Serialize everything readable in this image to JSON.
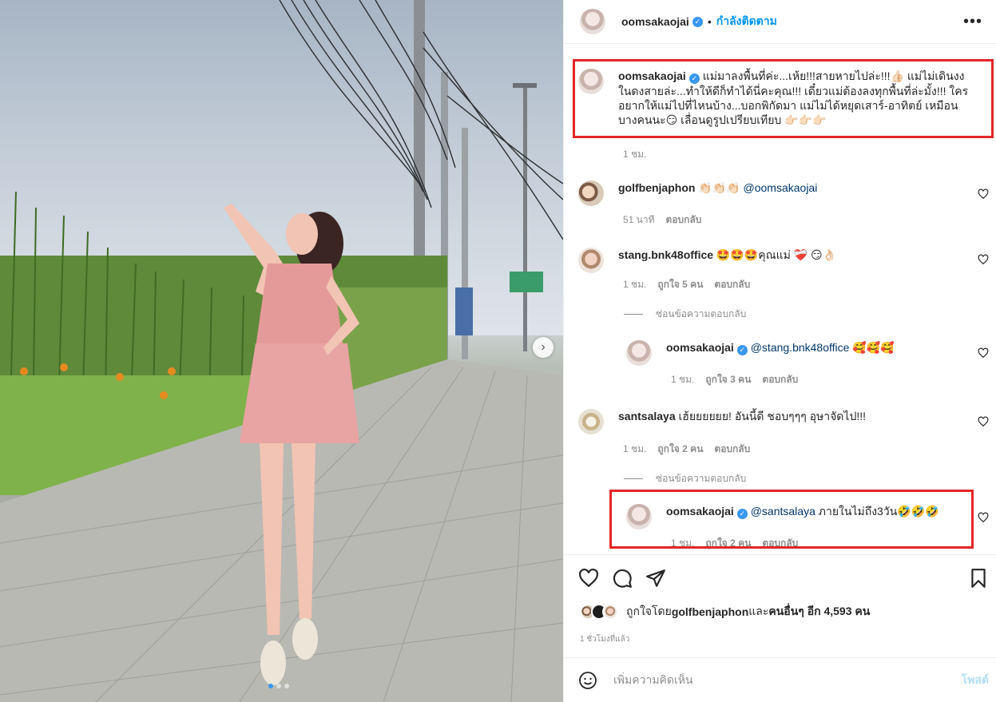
{
  "post": {
    "username": "oomsakaojai",
    "follow_status": "กำลังติดตาม",
    "caption": "แม่มาลงพื้นที่ค่ะ...เห้ย!!!สายหายไปล่ะ!!!👍🏻 แม่ไม่เดินงงในดงสายล่ะ...ทำให้ดีก็ทำได้นี่คะคุณ!!! เดี๋ยวแม่ต้องลงทุกพื้นที่ล่ะมั้ง!!! ใครอยากให้แม่ไปที่ไหนบ้าง...บอกพิกัดมา แม่ไม่ได้หยุดเสาร์-อาทิตย์ เหมือนบางคนนะ😏 เลื่อนดูรูปเปรียบเทียบ 👉🏻👉🏻👉🏻",
    "caption_time": "1 ชม."
  },
  "comments": [
    {
      "username": "golfbenjaphon",
      "emoji": "👏🏻👏🏻👏🏻",
      "text": " ",
      "mention": "@oomsakaojai",
      "time": "51 นาที",
      "reply": "ตอบกลับ"
    },
    {
      "username": "stang.bnk48office",
      "text": "🤩🤩🤩คุณแม่ ❤️‍🩹 😏👌🏻",
      "time": "1 ชม.",
      "likes": "ถูกใจ 5 คน",
      "reply": "ตอบกลับ",
      "hide_replies": "ซ่อนข้อความตอบกลับ"
    },
    {
      "username": "oomsakaojai",
      "mention": "@stang.bnk48office",
      "text": " 🥰🥰🥰",
      "time": "1 ชม.",
      "likes": "ถูกใจ 3 คน",
      "reply": "ตอบกลับ"
    },
    {
      "username": "santsalaya",
      "text": "เฮ้ยยยยยย! อันนี้ดี ชอบๆๆๆ อุษาจัดไป!!!",
      "time": "1 ชม.",
      "likes": "ถูกใจ 2 คน",
      "reply": "ตอบกลับ",
      "hide_replies": "ซ่อนข้อความตอบกลับ"
    },
    {
      "username": "oomsakaojai",
      "mention": "@santsalaya",
      "text": " ภายในไม่ถึง3วัน🤣🤣🤣",
      "time": "1 ชม.",
      "likes": "ถูกใจ 2 คน",
      "reply": "ตอบกลับ"
    }
  ],
  "likes_summary": {
    "prefix": "ถูกใจโดย ",
    "user": "golfbenjaphon",
    "middle": " และ ",
    "others": "คนอื่นๆ อีก 4,593 คน"
  },
  "timestamp": "1 ชั่วโมงที่แล้ว",
  "add_comment": {
    "placeholder": "เพิ่มความคิดเห็น",
    "post_label": "โพสต์"
  },
  "icons": [
    "heart-icon",
    "comment-icon",
    "share-icon",
    "bookmark-icon",
    "emoji-icon",
    "verified-icon",
    "more-icon",
    "chevron-right-icon"
  ],
  "colors": {
    "accent": "#0095f6",
    "verified": "#3897f0",
    "highlight_box": "#e32626"
  }
}
